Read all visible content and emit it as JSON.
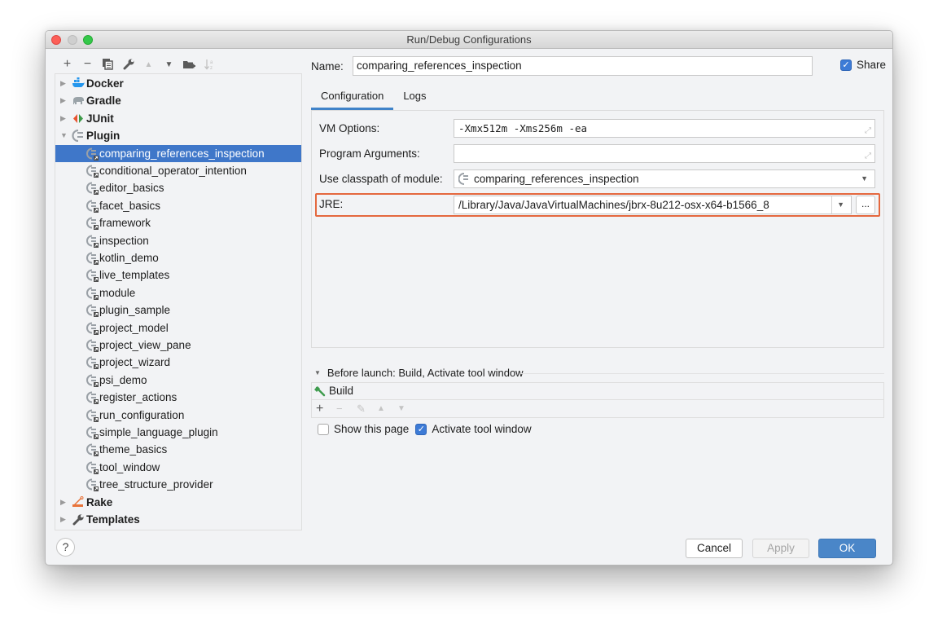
{
  "window": {
    "title": "Run/Debug Configurations"
  },
  "toolbar": {
    "buttons": [
      {
        "name": "add",
        "icon": "plus-icon",
        "glyph": "+",
        "enabled": true
      },
      {
        "name": "remove",
        "icon": "minus-icon",
        "glyph": "−",
        "enabled": true
      },
      {
        "name": "copy",
        "icon": "copy-icon",
        "glyph": "⧉",
        "enabled": true
      },
      {
        "name": "edit-defaults",
        "icon": "wrench-icon",
        "glyph": "🔧",
        "enabled": true
      },
      {
        "name": "move-up",
        "icon": "triangle-up-icon",
        "glyph": "▲",
        "enabled": false
      },
      {
        "name": "move-down",
        "icon": "triangle-down-icon",
        "glyph": "▼",
        "enabled": true
      },
      {
        "name": "new-folder",
        "icon": "folder-add-icon",
        "glyph": "📁",
        "enabled": true
      },
      {
        "name": "sort",
        "icon": "sort-alpha-icon",
        "glyph": "↓ᵃᶻ",
        "enabled": false
      }
    ]
  },
  "tree": {
    "groups_before": [
      {
        "label": "Docker",
        "icon": "docker-icon",
        "expanded": false
      },
      {
        "label": "Gradle",
        "icon": "gradle-elephant-icon",
        "expanded": false
      },
      {
        "label": "JUnit",
        "icon": "junit-icon",
        "expanded": false
      },
      {
        "label": "Plugin",
        "icon": "plugin-icon",
        "expanded": true
      }
    ],
    "plugin_children": [
      "comparing_references_inspection",
      "conditional_operator_intention",
      "editor_basics",
      "facet_basics",
      "framework",
      "inspection",
      "kotlin_demo",
      "live_templates",
      "module",
      "plugin_sample",
      "project_model",
      "project_view_pane",
      "project_wizard",
      "psi_demo",
      "register_actions",
      "run_configuration",
      "simple_language_plugin",
      "theme_basics",
      "tool_window",
      "tree_structure_provider"
    ],
    "selected": "comparing_references_inspection",
    "groups_after": [
      {
        "label": "Rake",
        "icon": "rake-icon",
        "expanded": false
      },
      {
        "label": "Templates",
        "icon": "wrench-icon",
        "expanded": false
      }
    ]
  },
  "form": {
    "name_label": "Name:",
    "name_value": "comparing_references_inspection",
    "share_label": "Share",
    "share_checked": true,
    "tabs": [
      {
        "label": "Configuration",
        "active": true
      },
      {
        "label": "Logs",
        "active": false
      }
    ],
    "vm_options_label": "VM Options:",
    "vm_options_value": "-Xmx512m -Xms256m -ea",
    "program_args_label": "Program Arguments:",
    "program_args_value": "",
    "classpath_label": "Use classpath of module:",
    "classpath_value": "comparing_references_inspection",
    "jre_label": "JRE:",
    "jre_value": "/Library/Java/JavaVirtualMachines/jbrx-8u212-osx-x64-b1566_8",
    "browse_label": "...",
    "highlight_color": "#e4683e"
  },
  "before_launch": {
    "header": "Before launch: Build, Activate tool window",
    "tasks": [
      {
        "label": "Build",
        "icon": "hammer-icon"
      }
    ],
    "tools": [
      {
        "name": "add",
        "glyph": "+",
        "enabled": true
      },
      {
        "name": "remove",
        "glyph": "−",
        "enabled": false
      },
      {
        "name": "edit",
        "glyph": "✎",
        "enabled": false
      },
      {
        "name": "move-up",
        "glyph": "▲",
        "enabled": false
      },
      {
        "name": "move-down",
        "glyph": "▼",
        "enabled": false
      }
    ],
    "show_page_label": "Show this page",
    "show_page_checked": false,
    "activate_window_label": "Activate tool window",
    "activate_window_checked": true
  },
  "footer": {
    "help_label": "?",
    "cancel_label": "Cancel",
    "apply_label": "Apply",
    "ok_label": "OK",
    "apply_enabled": false
  },
  "colors": {
    "selection": "#3f77c9",
    "primary_button": "#4a86c8",
    "checkbox": "#3d7bd6"
  }
}
